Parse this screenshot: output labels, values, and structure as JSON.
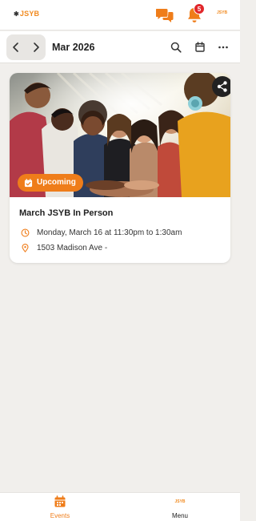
{
  "app": {
    "logo_text": "JSYB",
    "notification_count": "5",
    "accent_color": "#ef7d1a"
  },
  "header": {
    "icons": [
      "chat-bubbles-icon",
      "bell-icon"
    ]
  },
  "datebar": {
    "month_label": "Mar 2026",
    "icons": [
      "chevron-left-icon",
      "chevron-right-icon",
      "search-icon",
      "calendar-icon",
      "more-horizontal-icon"
    ]
  },
  "events": [
    {
      "status": "Upcoming",
      "title": "March JSYB In Person",
      "datetime": "Monday, March 16 at 11:30pm to 1:30am",
      "location": "1503 Madison Ave -"
    }
  ],
  "tabs": [
    {
      "label": "Events",
      "icon": "calendar-icon",
      "active": true
    },
    {
      "label": "Menu",
      "icon": "logo-icon",
      "active": false
    }
  ]
}
